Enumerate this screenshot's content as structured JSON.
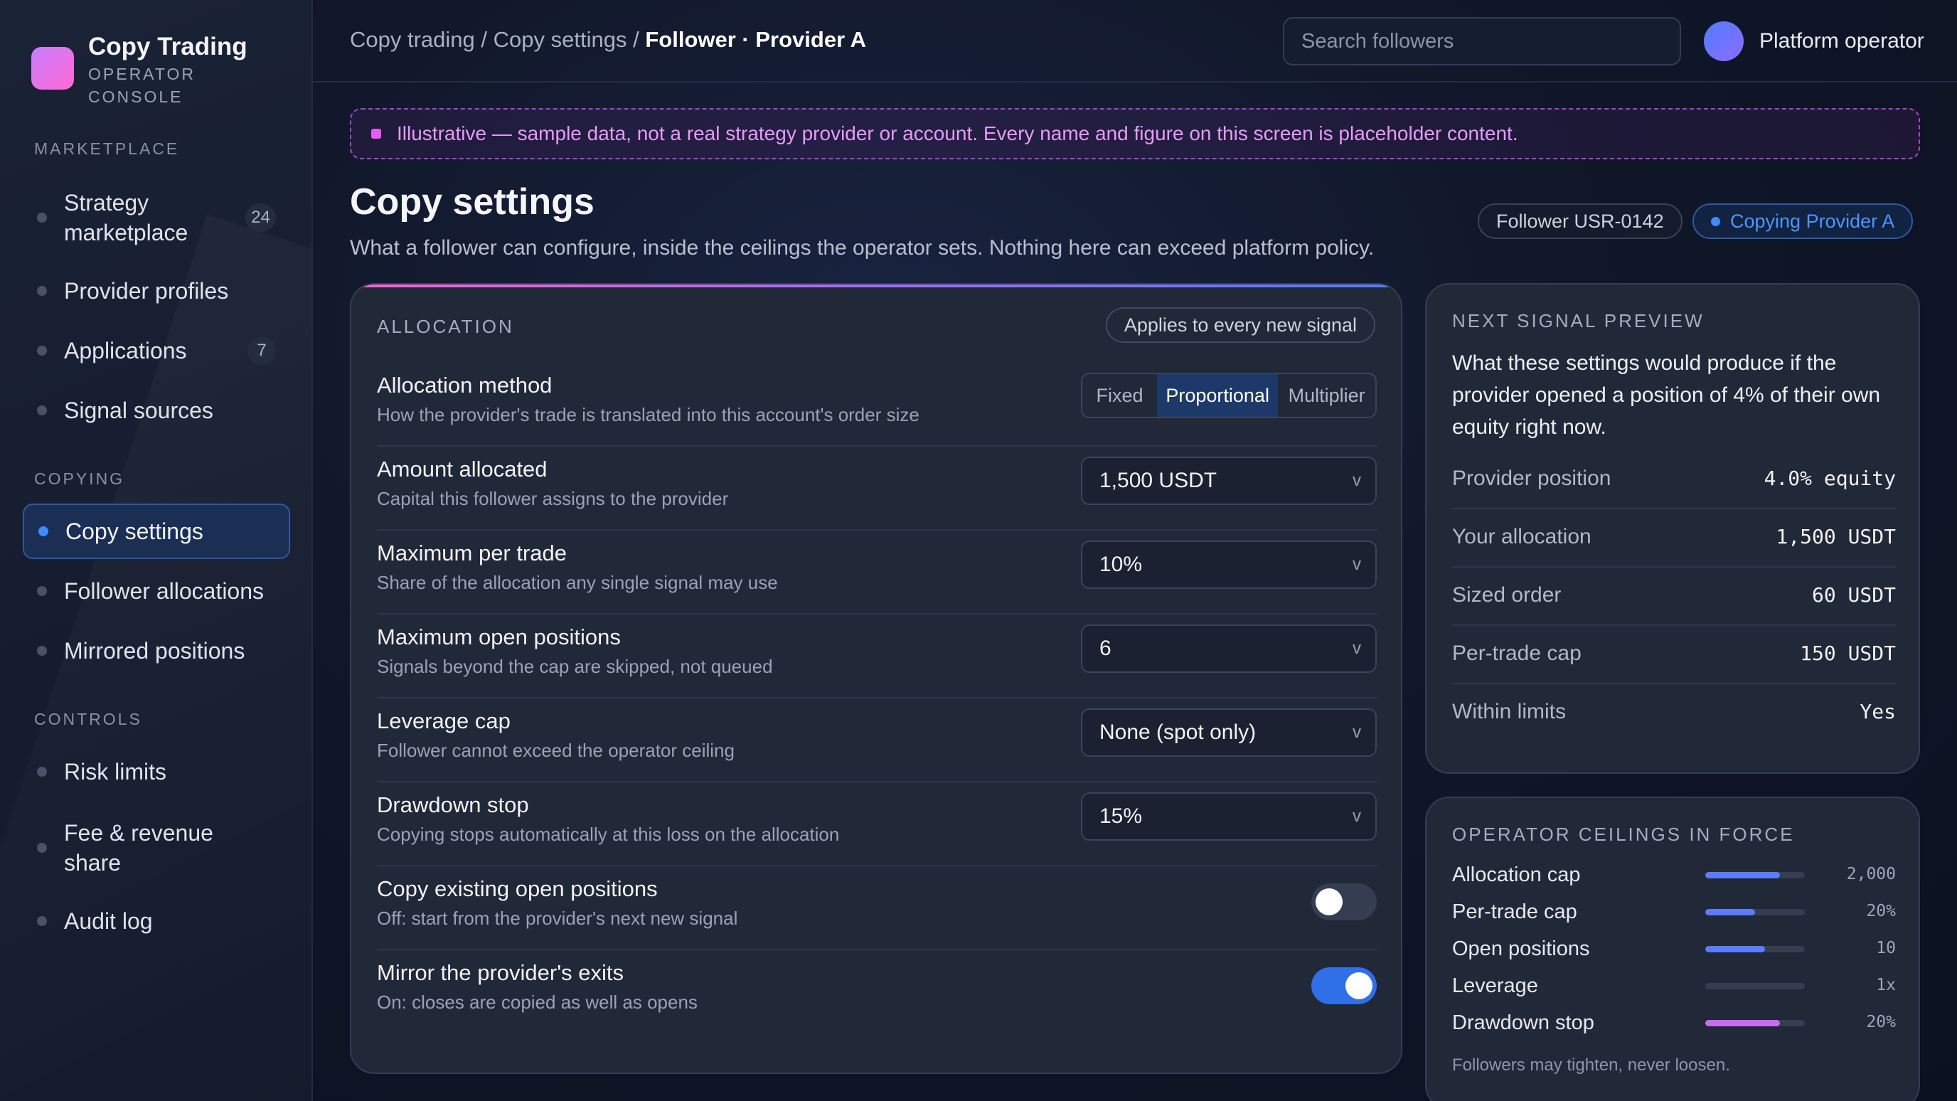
{
  "brand": {
    "title": "Copy Trading",
    "sub1": "OPERATOR",
    "sub2": "CONSOLE"
  },
  "sidebar": {
    "sections": [
      "MARKETPLACE",
      "COPYING",
      "CONTROLS"
    ],
    "items": [
      {
        "label1": "Strategy",
        "label2": "marketplace",
        "badge": "24"
      },
      {
        "label": "Provider profiles"
      },
      {
        "label": "Applications",
        "badge": "7"
      },
      {
        "label": "Signal sources"
      },
      {
        "label": "Copy settings",
        "active": true
      },
      {
        "label": "Follower allocations"
      },
      {
        "label": "Mirrored positions"
      },
      {
        "label": "Risk limits"
      },
      {
        "label1": "Fee & revenue",
        "label2": "share"
      },
      {
        "label": "Audit log"
      }
    ]
  },
  "header": {
    "crumb1": "Copy trading",
    "crumb2": "Copy settings",
    "crumb3": "Follower · Provider A",
    "sep": "/",
    "search_placeholder": "Search followers",
    "user": "Platform operator"
  },
  "banner": "Illustrative — sample data, not a real strategy provider or account. Every name and figure on this screen is placeholder content.",
  "page": {
    "title": "Copy settings",
    "subtitle": "What a follower can configure, inside the ceilings the operator sets. Nothing here can exceed platform policy.",
    "chip_follower": "Follower USR-0142",
    "chip_provider": "Copying Provider A"
  },
  "allocation": {
    "label": "ALLOCATION",
    "applies": "Applies to every new signal",
    "method": {
      "title": "Allocation method",
      "desc": "How the provider's trade is translated into this account's order size",
      "options": [
        "Fixed",
        "Proportional",
        "Multiplier"
      ],
      "selected": "Proportional"
    },
    "rows": [
      {
        "title": "Amount allocated",
        "desc": "Capital this follower assigns to the provider",
        "value": "1,500 USDT"
      },
      {
        "title": "Maximum per trade",
        "desc": "Share of the allocation any single signal may use",
        "value": "10%"
      },
      {
        "title": "Maximum open positions",
        "desc": "Signals beyond the cap are skipped, not queued",
        "value": "6"
      },
      {
        "title": "Leverage cap",
        "desc": "Follower cannot exceed the operator ceiling",
        "value": "None (spot only)"
      },
      {
        "title": "Drawdown stop",
        "desc": "Copying stops automatically at this loss on the allocation",
        "value": "15%"
      }
    ],
    "toggles": [
      {
        "title": "Copy existing open positions",
        "desc": "Off: start from the provider's next new signal",
        "on": false
      },
      {
        "title": "Mirror the provider's exits",
        "desc": "On: closes are copied as well as opens",
        "on": true
      }
    ],
    "chevron": "v"
  },
  "preview": {
    "label": "NEXT SIGNAL PREVIEW",
    "text": "What these settings would produce if the provider opened a position of 4% of their own equity right now.",
    "rows": [
      {
        "label": "Provider position",
        "value": "4.0% equity"
      },
      {
        "label": "Your allocation",
        "value": "1,500 USDT"
      },
      {
        "label": "Sized order",
        "value": "60 USDT"
      },
      {
        "label": "Per-trade cap",
        "value": "150 USDT"
      },
      {
        "label": "Within limits",
        "value": "Yes"
      }
    ]
  },
  "ceilings": {
    "label": "OPERATOR CEILINGS IN FORCE",
    "rows": [
      {
        "label": "Allocation cap",
        "value": "2,000",
        "fill": 0.75,
        "color": "#5b7cff"
      },
      {
        "label": "Per-trade cap",
        "value": "20%",
        "fill": 0.5,
        "color": "#5b7cff"
      },
      {
        "label": "Open positions",
        "value": "10",
        "fill": 0.6,
        "color": "#5b7cff"
      },
      {
        "label": "Leverage",
        "value": "1x",
        "fill": 0,
        "color": "#5b7cff"
      },
      {
        "label": "Drawdown stop",
        "value": "20%",
        "fill": 0.75,
        "color": "#c86bf5"
      }
    ],
    "note": "Followers may tighten, never loosen."
  },
  "colors": {
    "accent": "#3d8bff",
    "brand": "#ff6ad5",
    "banner": "#e89af6"
  }
}
